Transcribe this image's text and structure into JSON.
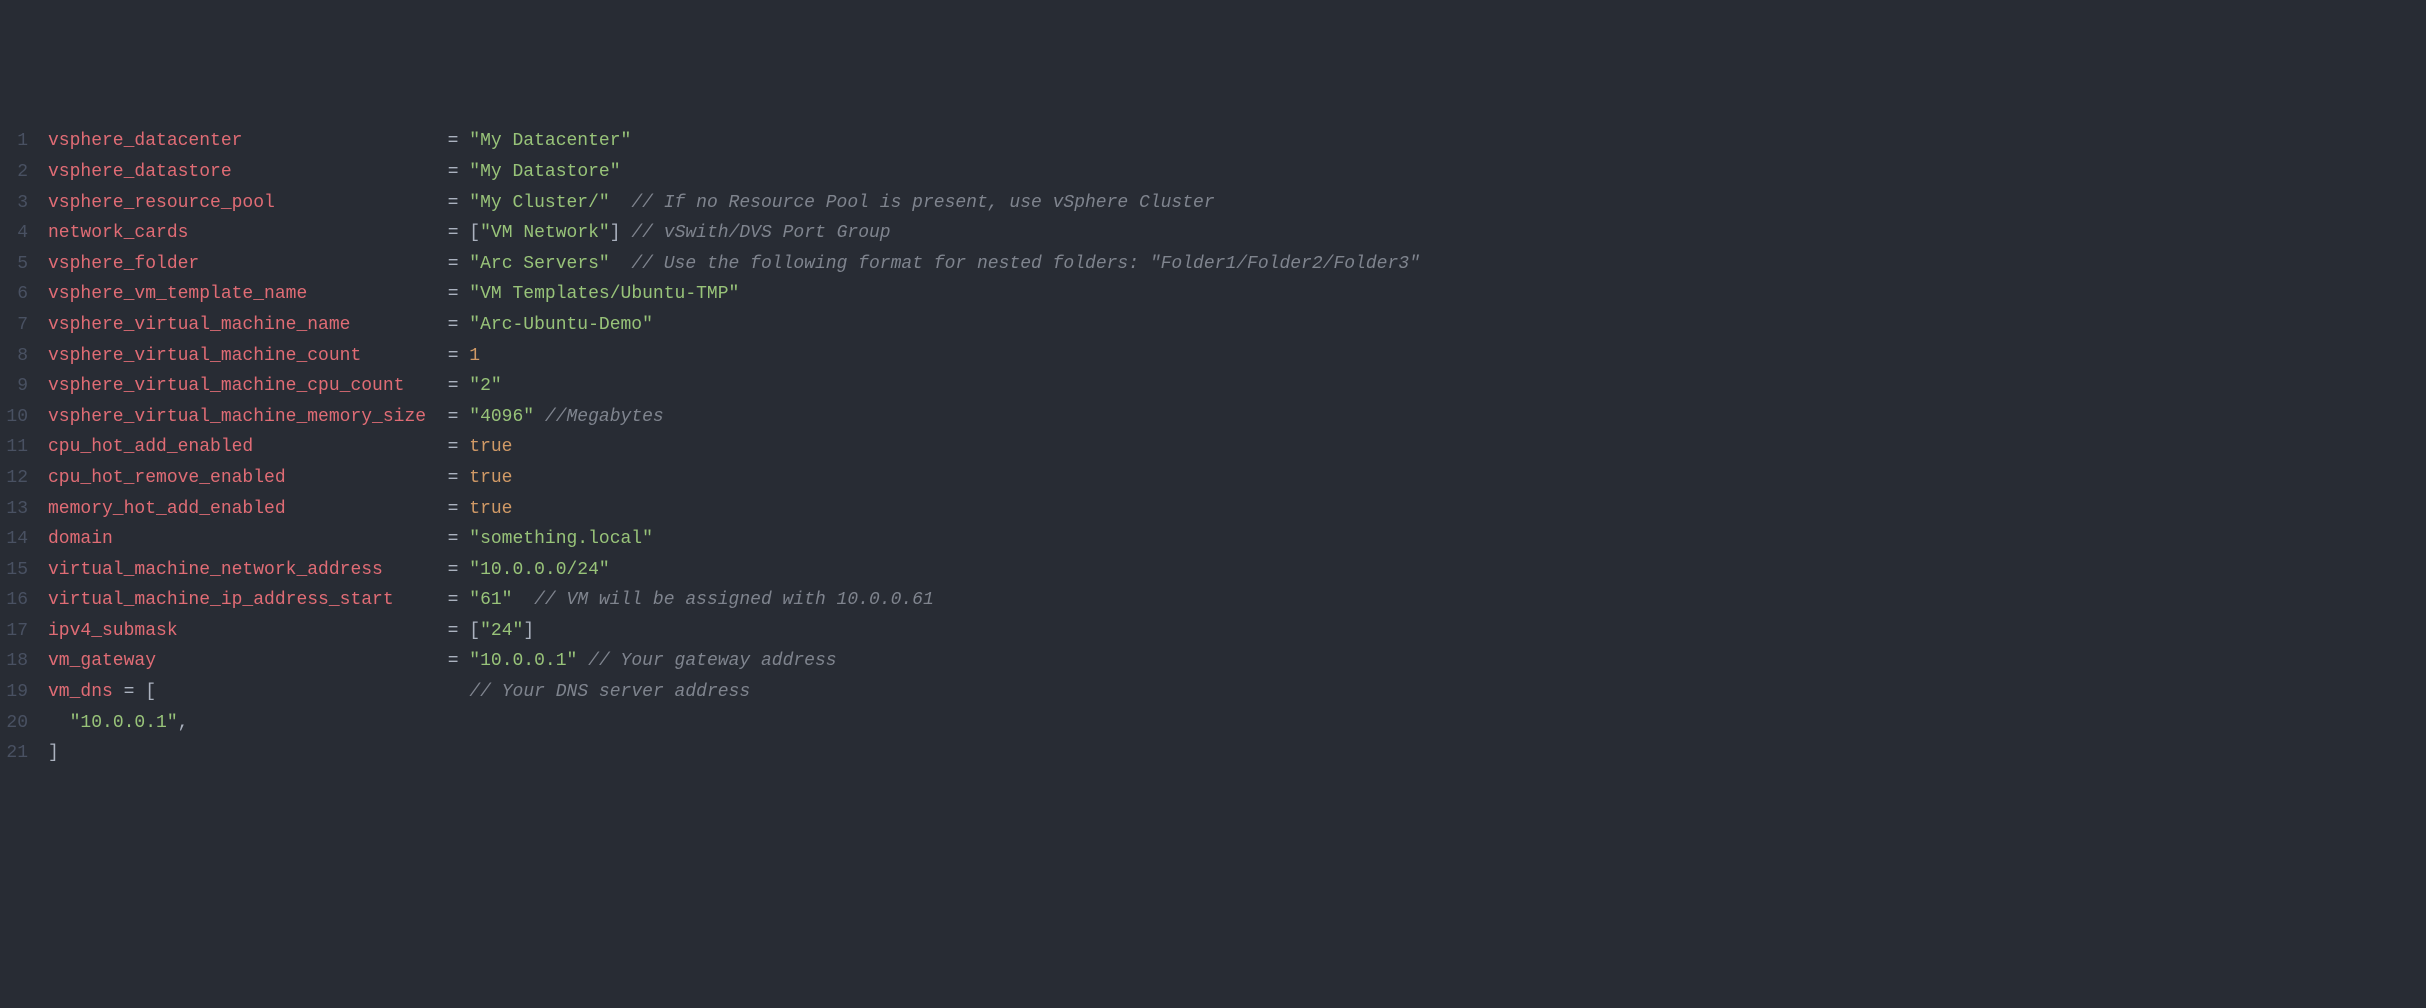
{
  "lines": [
    {
      "num": "1",
      "tokens": [
        {
          "t": "var",
          "v": "vsphere_datacenter"
        },
        {
          "t": "sp",
          "v": "                   "
        },
        {
          "t": "op",
          "v": "= "
        },
        {
          "t": "str",
          "v": "\"My Datacenter\""
        }
      ]
    },
    {
      "num": "2",
      "tokens": [
        {
          "t": "var",
          "v": "vsphere_datastore"
        },
        {
          "t": "sp",
          "v": "                    "
        },
        {
          "t": "op",
          "v": "= "
        },
        {
          "t": "str",
          "v": "\"My Datastore\""
        }
      ]
    },
    {
      "num": "3",
      "tokens": [
        {
          "t": "var",
          "v": "vsphere_resource_pool"
        },
        {
          "t": "sp",
          "v": "                "
        },
        {
          "t": "op",
          "v": "= "
        },
        {
          "t": "str",
          "v": "\"My Cluster/\""
        },
        {
          "t": "sp",
          "v": "  "
        },
        {
          "t": "comment",
          "v": "// If no Resource Pool is present, use vSphere Cluster"
        }
      ]
    },
    {
      "num": "4",
      "tokens": [
        {
          "t": "var",
          "v": "network_cards"
        },
        {
          "t": "sp",
          "v": "                        "
        },
        {
          "t": "op",
          "v": "= "
        },
        {
          "t": "punct",
          "v": "["
        },
        {
          "t": "str",
          "v": "\"VM Network\""
        },
        {
          "t": "punct",
          "v": "]"
        },
        {
          "t": "sp",
          "v": " "
        },
        {
          "t": "comment",
          "v": "// vSwith/DVS Port Group"
        }
      ]
    },
    {
      "num": "5",
      "tokens": [
        {
          "t": "var",
          "v": "vsphere_folder"
        },
        {
          "t": "sp",
          "v": "                       "
        },
        {
          "t": "op",
          "v": "= "
        },
        {
          "t": "str",
          "v": "\"Arc Servers\""
        },
        {
          "t": "sp",
          "v": "  "
        },
        {
          "t": "comment",
          "v": "// Use the following format for nested folders: \"Folder1/Folder2/Folder3\""
        }
      ]
    },
    {
      "num": "6",
      "tokens": [
        {
          "t": "var",
          "v": "vsphere_vm_template_name"
        },
        {
          "t": "sp",
          "v": "             "
        },
        {
          "t": "op",
          "v": "= "
        },
        {
          "t": "str",
          "v": "\"VM Templates/Ubuntu-TMP\""
        }
      ]
    },
    {
      "num": "7",
      "tokens": [
        {
          "t": "var",
          "v": "vsphere_virtual_machine_name"
        },
        {
          "t": "sp",
          "v": "         "
        },
        {
          "t": "op",
          "v": "= "
        },
        {
          "t": "str",
          "v": "\"Arc-Ubuntu-Demo\""
        }
      ]
    },
    {
      "num": "8",
      "tokens": [
        {
          "t": "var",
          "v": "vsphere_virtual_machine_count"
        },
        {
          "t": "sp",
          "v": "        "
        },
        {
          "t": "op",
          "v": "= "
        },
        {
          "t": "num",
          "v": "1"
        }
      ]
    },
    {
      "num": "9",
      "tokens": [
        {
          "t": "var",
          "v": "vsphere_virtual_machine_cpu_count"
        },
        {
          "t": "sp",
          "v": "    "
        },
        {
          "t": "op",
          "v": "= "
        },
        {
          "t": "str",
          "v": "\"2\""
        }
      ]
    },
    {
      "num": "10",
      "tokens": [
        {
          "t": "var",
          "v": "vsphere_virtual_machine_memory_size"
        },
        {
          "t": "sp",
          "v": "  "
        },
        {
          "t": "op",
          "v": "= "
        },
        {
          "t": "str",
          "v": "\"4096\""
        },
        {
          "t": "sp",
          "v": " "
        },
        {
          "t": "comment",
          "v": "//Megabytes"
        }
      ]
    },
    {
      "num": "11",
      "tokens": [
        {
          "t": "var",
          "v": "cpu_hot_add_enabled"
        },
        {
          "t": "sp",
          "v": "                  "
        },
        {
          "t": "op",
          "v": "= "
        },
        {
          "t": "bool",
          "v": "true"
        }
      ]
    },
    {
      "num": "12",
      "tokens": [
        {
          "t": "var",
          "v": "cpu_hot_remove_enabled"
        },
        {
          "t": "sp",
          "v": "               "
        },
        {
          "t": "op",
          "v": "= "
        },
        {
          "t": "bool",
          "v": "true"
        }
      ]
    },
    {
      "num": "13",
      "tokens": [
        {
          "t": "var",
          "v": "memory_hot_add_enabled"
        },
        {
          "t": "sp",
          "v": "               "
        },
        {
          "t": "op",
          "v": "= "
        },
        {
          "t": "bool",
          "v": "true"
        }
      ]
    },
    {
      "num": "14",
      "tokens": [
        {
          "t": "var",
          "v": "domain"
        },
        {
          "t": "sp",
          "v": "                               "
        },
        {
          "t": "op",
          "v": "= "
        },
        {
          "t": "str",
          "v": "\"something.local\""
        }
      ]
    },
    {
      "num": "15",
      "tokens": [
        {
          "t": "var",
          "v": "virtual_machine_network_address"
        },
        {
          "t": "sp",
          "v": "      "
        },
        {
          "t": "op",
          "v": "= "
        },
        {
          "t": "str",
          "v": "\"10.0.0.0/24\""
        }
      ]
    },
    {
      "num": "16",
      "tokens": [
        {
          "t": "var",
          "v": "virtual_machine_ip_address_start"
        },
        {
          "t": "sp",
          "v": "     "
        },
        {
          "t": "op",
          "v": "= "
        },
        {
          "t": "str",
          "v": "\"61\""
        },
        {
          "t": "sp",
          "v": "  "
        },
        {
          "t": "comment",
          "v": "// VM will be assigned with 10.0.0.61"
        }
      ]
    },
    {
      "num": "17",
      "tokens": [
        {
          "t": "var",
          "v": "ipv4_submask"
        },
        {
          "t": "sp",
          "v": "                         "
        },
        {
          "t": "op",
          "v": "= "
        },
        {
          "t": "punct",
          "v": "["
        },
        {
          "t": "str",
          "v": "\"24\""
        },
        {
          "t": "punct",
          "v": "]"
        }
      ]
    },
    {
      "num": "18",
      "tokens": [
        {
          "t": "var",
          "v": "vm_gateway"
        },
        {
          "t": "sp",
          "v": "                           "
        },
        {
          "t": "op",
          "v": "= "
        },
        {
          "t": "str",
          "v": "\"10.0.0.1\""
        },
        {
          "t": "sp",
          "v": " "
        },
        {
          "t": "comment",
          "v": "// Your gateway address"
        }
      ]
    },
    {
      "num": "19",
      "tokens": [
        {
          "t": "var",
          "v": "vm_dns"
        },
        {
          "t": "sp",
          "v": " "
        },
        {
          "t": "op",
          "v": "= "
        },
        {
          "t": "punct",
          "v": "["
        },
        {
          "t": "sp",
          "v": "                             "
        },
        {
          "t": "comment",
          "v": "// Your DNS server address"
        }
      ]
    },
    {
      "num": "20",
      "tokens": [
        {
          "t": "sp",
          "v": "  "
        },
        {
          "t": "str",
          "v": "\"10.0.0.1\""
        },
        {
          "t": "punct",
          "v": ","
        }
      ]
    },
    {
      "num": "21",
      "tokens": [
        {
          "t": "punct",
          "v": "]"
        }
      ]
    }
  ]
}
